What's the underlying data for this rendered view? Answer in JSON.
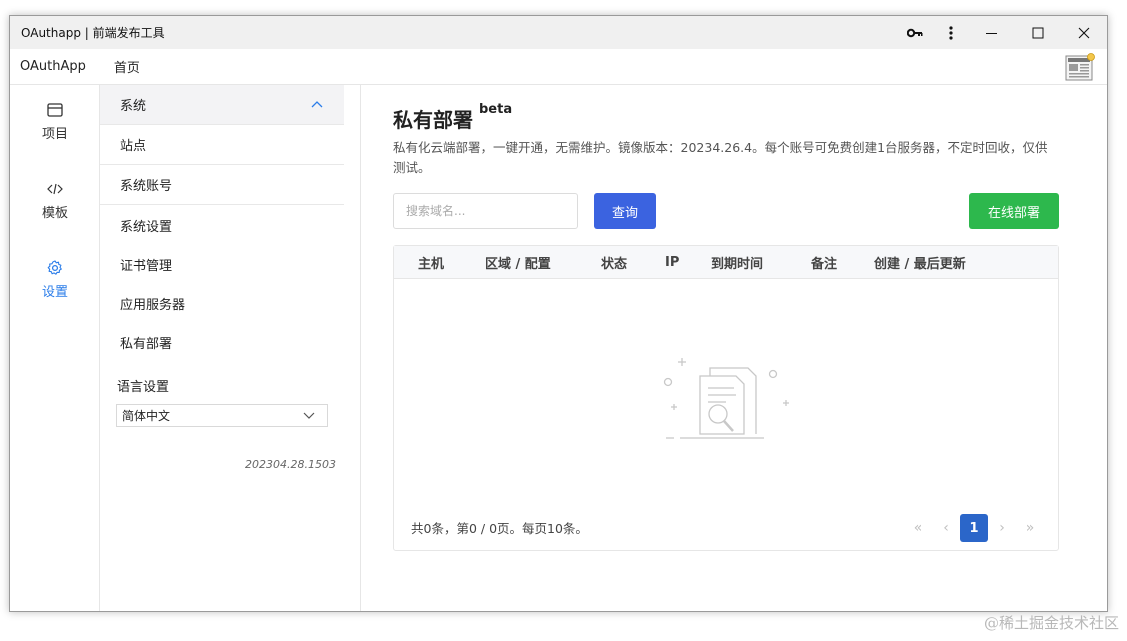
{
  "window": {
    "title": "OAuthapp | 前端发布工具",
    "controls": {
      "key_icon": "key-icon",
      "more_icon": "more-icon"
    }
  },
  "menubar": {
    "app_name": "OAuthApp",
    "home": "首页"
  },
  "iconnav": {
    "items": [
      {
        "label": "项目",
        "icon": "calendar-icon",
        "active": false
      },
      {
        "label": "模板",
        "icon": "code-icon",
        "active": false
      },
      {
        "label": "设置",
        "icon": "gear-icon",
        "active": true
      }
    ]
  },
  "subnav": {
    "group_title": "系统",
    "items": [
      "站点",
      "系统账号",
      "系统设置",
      "证书管理",
      "应用服务器",
      "私有部署"
    ],
    "lang_label": "语言设置",
    "lang_value": "简体中文",
    "version": "202304.28.1503"
  },
  "main": {
    "title": "私有部署",
    "badge": "beta",
    "description": "私有化云端部署，一键开通，无需维护。镜像版本：20234.26.4。每个账号可免费创建1台服务器，不定时回收，仅供测试。",
    "search_placeholder": "搜索域名...",
    "query_label": "查询",
    "deploy_label": "在线部署",
    "columns": [
      "主机",
      "区域 / 配置",
      "状态",
      "IP",
      "到期时间",
      "备注",
      "创建 / 最后更新"
    ],
    "footer": "共0条，第0 / 0页。每页10条。",
    "current_page": "1"
  },
  "colors": {
    "accent": "#3b63e0",
    "success": "#2db84d",
    "active_nav": "#2b7de9"
  },
  "watermark": "@稀土掘金技术社区"
}
